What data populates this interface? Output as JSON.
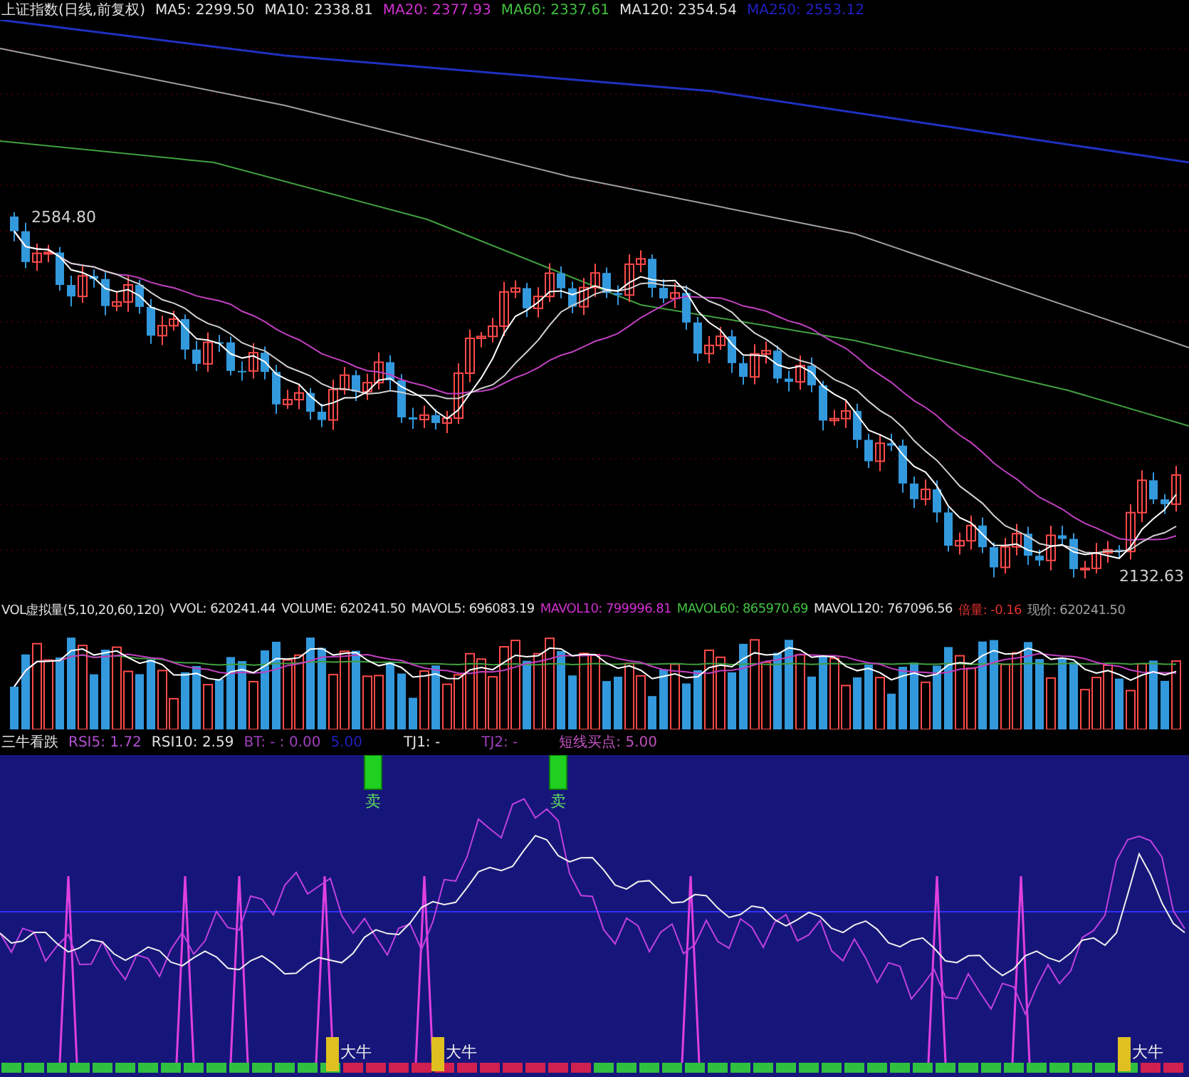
{
  "main_panel": {
    "title": "上证指数(日线,前复权)",
    "indicators": [
      {
        "text": "MA5: 2299.50",
        "color": "#e0e0e0"
      },
      {
        "text": "MA10: 2338.81",
        "color": "#e0e0e0"
      },
      {
        "text": "MA20: 2377.93",
        "color": "#d030d0"
      },
      {
        "text": "MA60: 2337.61",
        "color": "#40c040"
      },
      {
        "text": "MA120: 2354.54",
        "color": "#e0e0e0"
      },
      {
        "text": "MA250: 2553.12",
        "color": "#2020c0"
      }
    ],
    "high_label": "2584.80",
    "low_label": "2132.63"
  },
  "volume_panel": {
    "title": "VOL虚拟量(5,10,20,60,120)",
    "indicators": [
      {
        "text": "VVOL: 620241.44",
        "color": "#e0e0e0"
      },
      {
        "text": "VOLUME: 620241.50",
        "color": "#e0e0e0"
      },
      {
        "text": "MAVOL5: 696083.19",
        "color": "#e0e0e0"
      },
      {
        "text": "MAVOL10: 799996.81",
        "color": "#d030d0"
      },
      {
        "text": "MAVOL60: 865970.69",
        "color": "#40c040"
      },
      {
        "text": "MAVOL120: 767096.56",
        "color": "#e0e0e0"
      },
      {
        "text": "倍量: -0.16",
        "color": "#e03030"
      },
      {
        "text": "现价: 620241.50",
        "color": "#a0a0a0"
      }
    ]
  },
  "indicator_panel": {
    "title": "三牛看跌",
    "indicators": [
      {
        "text": "RSI5: 1.72",
        "color": "#b050d0"
      },
      {
        "text": "RSI10: 2.59",
        "color": "#e0e0e0"
      },
      {
        "text": "BT: - : 0.00",
        "color": "#a040c0"
      },
      {
        "text": "5.00",
        "color": "#2020c0"
      },
      {
        "text": "TJ1: -",
        "color": "#e0e0e0"
      },
      {
        "text": "TJ2: -",
        "color": "#a040c0"
      },
      {
        "text": "短线买点: 5.00",
        "color": "#c050c0"
      }
    ],
    "sell_signals": [
      {
        "label": "卖"
      },
      {
        "label": "卖"
      }
    ],
    "bull_signals": [
      {
        "label": "大牛"
      },
      {
        "label": "大牛"
      },
      {
        "label": "大牛"
      }
    ]
  }
}
